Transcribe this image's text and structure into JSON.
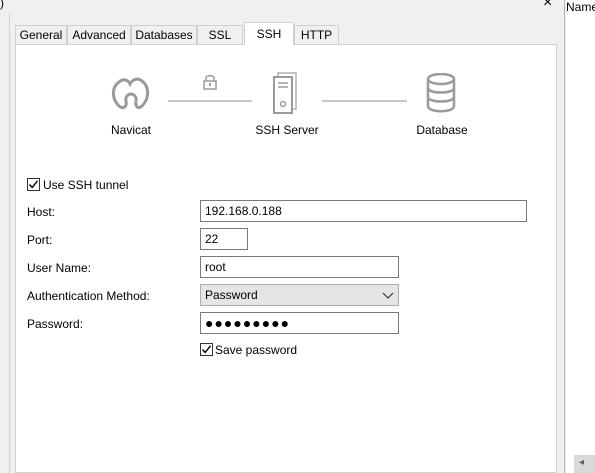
{
  "window": {
    "title_fragment": ")",
    "close_glyph": "×"
  },
  "background": {
    "column_name": "Name"
  },
  "tabs": [
    {
      "label": "General",
      "active": false
    },
    {
      "label": "Advanced",
      "active": false
    },
    {
      "label": "Databases",
      "active": false
    },
    {
      "label": "SSL",
      "active": false
    },
    {
      "label": "SSH",
      "active": true
    },
    {
      "label": "HTTP",
      "active": false
    }
  ],
  "diagram": {
    "source_label": "Navicat",
    "middle_label": "SSH Server",
    "target_label": "Database",
    "icons": [
      "navicat-logo-icon",
      "lock-icon",
      "server-icon",
      "database-icon"
    ]
  },
  "ssh": {
    "use_tunnel_label": "Use SSH tunnel",
    "use_tunnel_checked": true,
    "host_label": "Host:",
    "host_value": "192.168.0.188",
    "port_label": "Port:",
    "port_value": "22",
    "username_label": "User Name:",
    "username_value": "root",
    "auth_label": "Authentication Method:",
    "auth_value": "Password",
    "password_label": "Password:",
    "password_masked": "●●●●●●●●●",
    "save_password_label": "Save password",
    "save_password_checked": true
  },
  "colors": {
    "panel": "#ffffff",
    "window": "#f0f0f0",
    "icon_gray": "#9a9a9a"
  }
}
